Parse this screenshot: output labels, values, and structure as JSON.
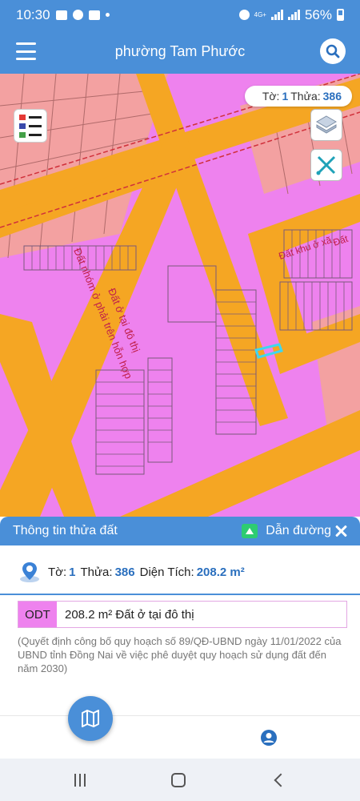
{
  "status_bar": {
    "time": "10:30",
    "battery": "56%",
    "network_label": "4G+"
  },
  "header": {
    "title": "phường Tam Phước"
  },
  "map": {
    "parcel_badge": {
      "sheet_label": "Tờ:",
      "sheet_value": "1",
      "plot_label": "Thửa:",
      "plot_value": "386"
    },
    "labels": {
      "diagonal_label": "Đất ở tại đô thị",
      "diagonal_label_2": "Đất nhóm ở phải trên hỗn hợp",
      "right_label": "Đất khu ở xã",
      "right_label_short": "Đất"
    },
    "colors": {
      "residential": "#ee82ee",
      "road": "#f5a623",
      "mixed": "#f3a1a1"
    }
  },
  "info_panel": {
    "header_title": "Thông tin thửa đất",
    "directions_label": "Dẫn đường",
    "sheet_label": "Tờ:",
    "sheet_value": "1",
    "plot_label": "Thửa:",
    "plot_value": "386",
    "area_label": "Diện Tích:",
    "area_value": "208.2 m²",
    "usage_code": "ODT",
    "usage_desc": "208.2 m²  Đất ở tại đô thị",
    "note": "(Quyết định công bố quy hoạch số 89/QĐ-UBND ngày 11/01/2022 của UBND tỉnh Đồng Nai về việc phê duyệt quy hoạch sử dụng đất đến năm 2030)"
  },
  "icons": {
    "menu": "hamburger-icon",
    "search": "search-icon",
    "legend": "legend-icon",
    "layers": "layers-icon",
    "tools": "ruler-tools-icon",
    "directions": "directions-icon",
    "close": "close-icon",
    "location": "location-pin-icon",
    "map": "map-icon",
    "profile": "profile-icon"
  }
}
